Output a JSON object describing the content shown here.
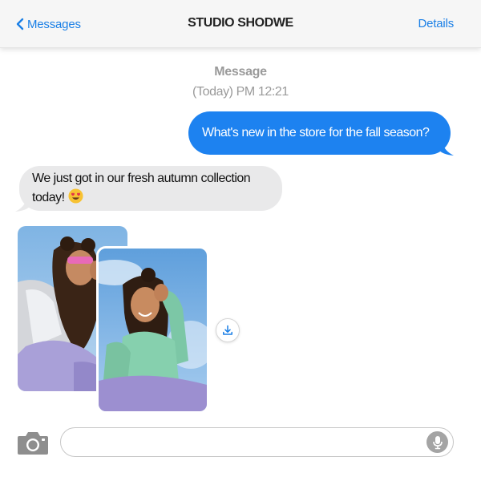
{
  "header": {
    "back_label": "Messages",
    "title": "STUDIO SHODWE",
    "details_label": "Details"
  },
  "timestamp": {
    "label": "Message",
    "time": "(Today) PM 12:21"
  },
  "messages": [
    {
      "direction": "outgoing",
      "text": "What's new in the store for the fall season?"
    },
    {
      "direction": "incoming",
      "text_line1": "We just got in our fresh autumn collection",
      "text_line2": "today!",
      "emoji": "heart-eyes-emoji"
    }
  ],
  "attachments": {
    "photos": [
      {
        "name": "photo-girl-sunglasses"
      },
      {
        "name": "photo-girl-green-top"
      }
    ],
    "download_icon": "download-icon"
  },
  "composer": {
    "camera_icon": "camera-icon",
    "input_value": "",
    "input_placeholder": "",
    "mic_icon": "microphone-icon"
  },
  "colors": {
    "accent": "#1a7fe6",
    "outgoing_bubble": "#1d82f0",
    "incoming_bubble": "#e9e9ea",
    "header_bg": "#f6f6f6",
    "muted_text": "#9a9a9a"
  }
}
